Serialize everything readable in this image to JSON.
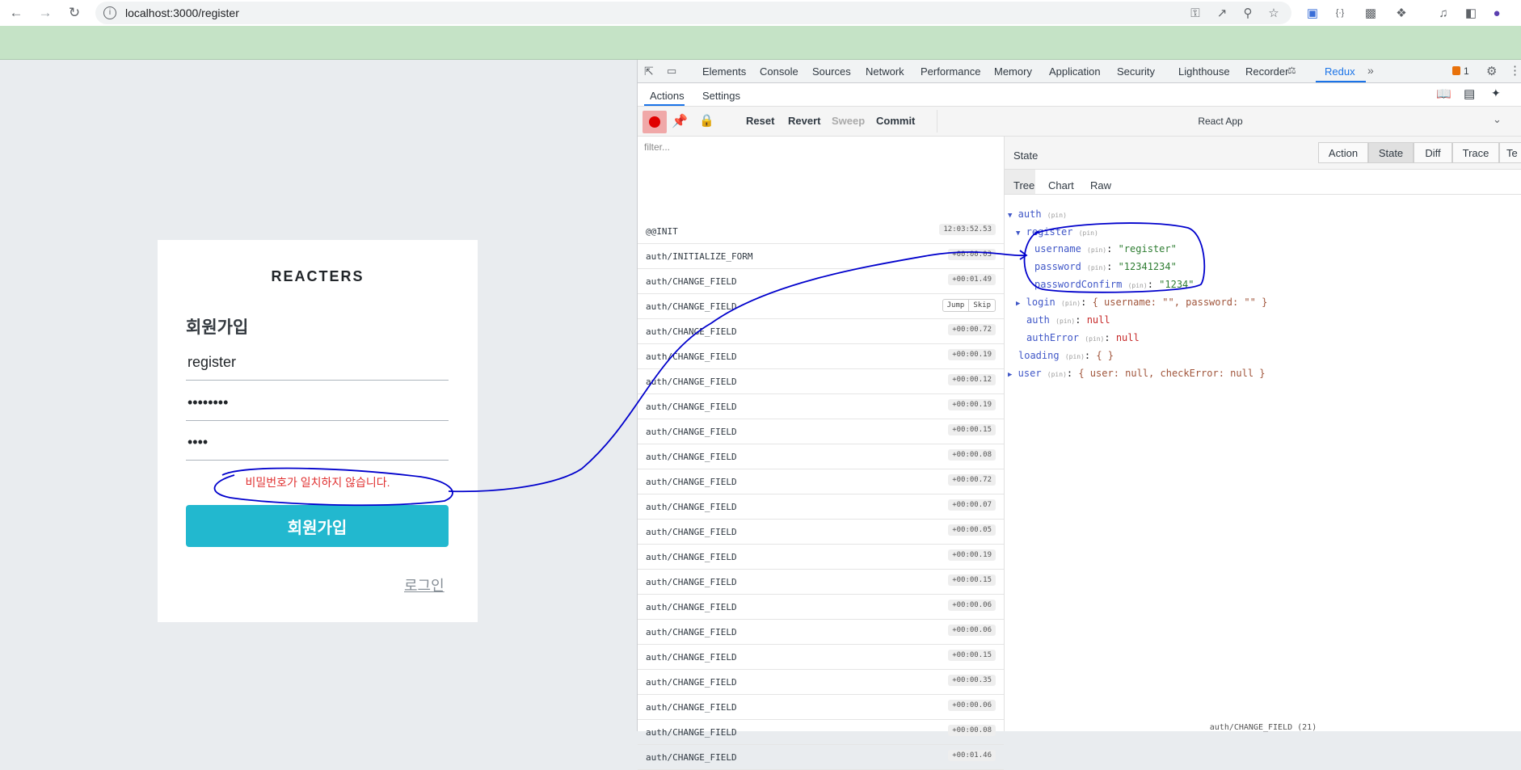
{
  "browser": {
    "url": "localhost:3000/register",
    "icons": [
      "back-icon",
      "forward-icon",
      "reload-icon",
      "site-info-icon",
      "key-icon",
      "open-external-icon",
      "zoom-icon",
      "star-icon",
      "extension-icon",
      "puzzle-icon",
      "media-icon",
      "sidepanel-icon",
      "profile-icon"
    ]
  },
  "app": {
    "brand": "REACTERS",
    "title": "회원가입",
    "username": "register",
    "password": "••••••••",
    "password_confirm": "••••",
    "error": "비밀번호가 일치하지 않습니다.",
    "submit": "회원가입",
    "login_link": "로그인"
  },
  "devtools": {
    "tabs": [
      "Elements",
      "Console",
      "Sources",
      "Network",
      "Performance",
      "Memory",
      "Application",
      "Security",
      "Lighthouse",
      "Recorder",
      "Redux"
    ],
    "active_tab": "Redux",
    "issues_count": "1",
    "subtabs": [
      "Actions",
      "Settings"
    ],
    "toolbar": [
      "Reset",
      "Revert",
      "Sweep",
      "Commit"
    ],
    "instance": "React App",
    "filter_placeholder": "filter...",
    "actions": [
      {
        "name": "@@INIT",
        "time": "12:03:52.53"
      },
      {
        "name": "auth/INITIALIZE_FORM",
        "time": "+00:00.03"
      },
      {
        "name": "auth/CHANGE_FIELD",
        "time": "+00:01.49"
      },
      {
        "name": "auth/CHANGE_FIELD",
        "time": "",
        "jump": "Jump",
        "skip": "Skip"
      },
      {
        "name": "auth/CHANGE_FIELD",
        "time": "+00:00.72"
      },
      {
        "name": "auth/CHANGE_FIELD",
        "time": "+00:00.19"
      },
      {
        "name": "auth/CHANGE_FIELD",
        "time": "+00:00.12"
      },
      {
        "name": "auth/CHANGE_FIELD",
        "time": "+00:00.19"
      },
      {
        "name": "auth/CHANGE_FIELD",
        "time": "+00:00.15"
      },
      {
        "name": "auth/CHANGE_FIELD",
        "time": "+00:00.08"
      },
      {
        "name": "auth/CHANGE_FIELD",
        "time": "+00:00.72"
      },
      {
        "name": "auth/CHANGE_FIELD",
        "time": "+00:00.07"
      },
      {
        "name": "auth/CHANGE_FIELD",
        "time": "+00:00.05"
      },
      {
        "name": "auth/CHANGE_FIELD",
        "time": "+00:00.19"
      },
      {
        "name": "auth/CHANGE_FIELD",
        "time": "+00:00.15"
      },
      {
        "name": "auth/CHANGE_FIELD",
        "time": "+00:00.06"
      },
      {
        "name": "auth/CHANGE_FIELD",
        "time": "+00:00.06"
      },
      {
        "name": "auth/CHANGE_FIELD",
        "time": "+00:00.15"
      },
      {
        "name": "auth/CHANGE_FIELD",
        "time": "+00:00.35"
      },
      {
        "name": "auth/CHANGE_FIELD",
        "time": "+00:00.06"
      },
      {
        "name": "auth/CHANGE_FIELD",
        "time": "+00:00.08"
      },
      {
        "name": "auth/CHANGE_FIELD",
        "time": "+00:01.46"
      }
    ],
    "state_title": "State",
    "monitor_tabs": [
      "Action",
      "State",
      "Diff",
      "Trace",
      "Te"
    ],
    "monitor_active": "State",
    "view_tabs": [
      "Tree",
      "Chart",
      "Raw"
    ],
    "view_active": "Tree",
    "tree": {
      "auth": "auth",
      "pin": "(pin)",
      "register": "register",
      "username_key": "username",
      "username_val": "\"register\"",
      "password_key": "password",
      "password_val": "\"12341234\"",
      "passwordConfirm_key": "passwordConfirm",
      "passwordConfirm_val": "\"1234\"",
      "login_key": "login",
      "login_val": "{ username: \"\", password: \"\" }",
      "auth_key": "auth",
      "null": "null",
      "authError_key": "authError",
      "loading_key": "loading",
      "loading_val": "{ }",
      "user_key": "user",
      "user_val": "{ user: null, checkError: null }"
    },
    "status": "auth/CHANGE_FIELD (21)"
  },
  "colors": {
    "accent": "#22b8cf",
    "error": "#e03131",
    "annotation": "#0000cc",
    "chrome_green": "#c5e3c6"
  }
}
